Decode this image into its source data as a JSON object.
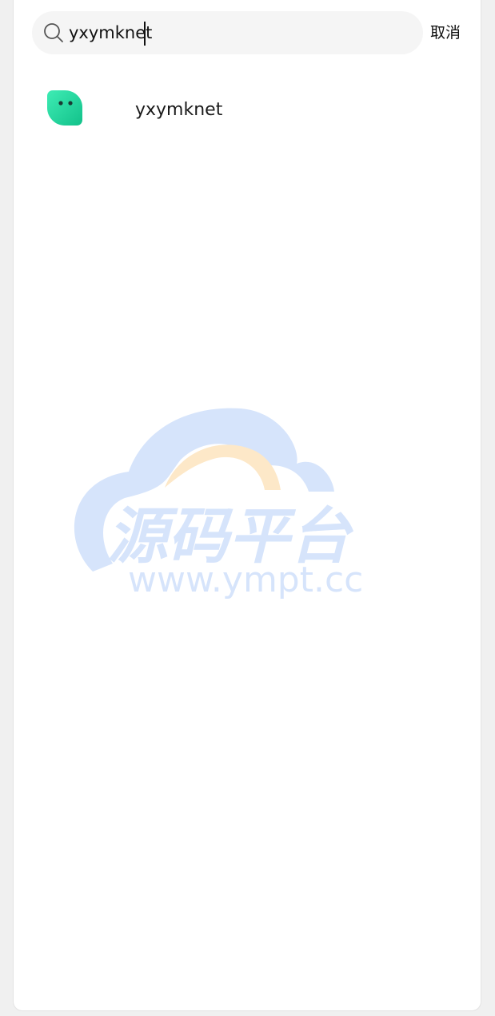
{
  "search": {
    "value": "yxymknet",
    "cancel_label": "取消"
  },
  "results": [
    {
      "name": "yxymknet",
      "avatar": "green-chat-bubble-avatar"
    }
  ],
  "watermark": {
    "title": "源码平台",
    "url": "www.ympt.cc"
  },
  "colors": {
    "avatar_gradient_start": "#3be8b0",
    "avatar_gradient_end": "#14c48c",
    "search_bg": "#f5f5f5",
    "watermark_blue": "#d6e4fb",
    "watermark_orange": "#fde8c8"
  }
}
